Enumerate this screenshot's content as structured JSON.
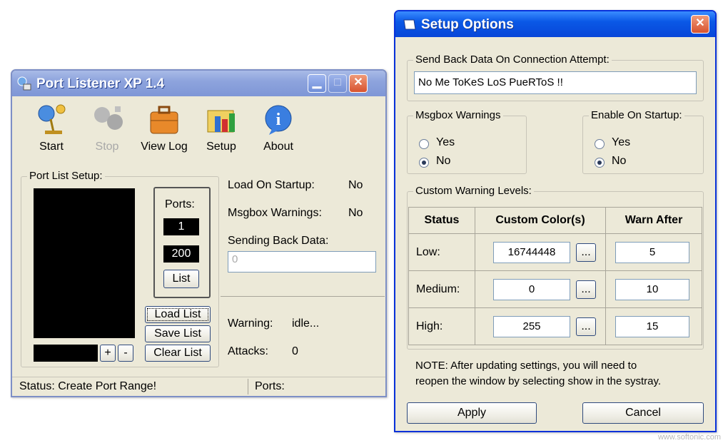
{
  "listener": {
    "title": "Port Listener XP 1.4",
    "toolbar": [
      {
        "label": "Start",
        "icon": "network-start-icon",
        "enabled": true
      },
      {
        "label": "Stop",
        "icon": "network-stop-icon",
        "enabled": false
      },
      {
        "label": "View Log",
        "icon": "briefcase-icon",
        "enabled": true
      },
      {
        "label": "Setup",
        "icon": "folder-setup-icon",
        "enabled": true
      },
      {
        "label": "About",
        "icon": "info-icon",
        "enabled": true
      }
    ],
    "port_list_setup": {
      "legend": "Port List Setup:",
      "ports_legend": "Ports:",
      "port_from": "1",
      "port_to": "200",
      "list_button": "List",
      "load_list": "Load List",
      "save_list": "Save List",
      "clear_list": "Clear List",
      "plus": "+",
      "minus": "-"
    },
    "info": {
      "load_on_startup_label": "Load On Startup:",
      "load_on_startup_value": "No",
      "msgbox_warnings_label": "Msgbox Warnings:",
      "msgbox_warnings_value": "No",
      "sending_back_label": "Sending Back Data:",
      "sending_back_value": "0",
      "warning_label": "Warning:",
      "warning_value": "idle...",
      "attacks_label": "Attacks:",
      "attacks_value": "0"
    },
    "status": {
      "left": "Status:  Create Port Range!",
      "right": "Ports:"
    }
  },
  "setup": {
    "title": "Setup Options",
    "send_back_legend": "Send Back Data On Connection Attempt:",
    "send_back_value": "No Me ToKeS LoS PueRToS !!",
    "msgbox_legend": "Msgbox Warnings",
    "startup_legend": "Enable On Startup:",
    "yes": "Yes",
    "no": "No",
    "levels_legend": "Custom Warning Levels:",
    "headers": {
      "status": "Status",
      "color": "Custom Color(s)",
      "warn": "Warn After"
    },
    "rows": [
      {
        "status": "Low:",
        "color": "16744448",
        "warn": "5"
      },
      {
        "status": "Medium:",
        "color": "0",
        "warn": "10"
      },
      {
        "status": "High:",
        "color": "255",
        "warn": "15"
      }
    ],
    "browse": "...",
    "note_line1": "NOTE:  After updating settings, you will need to",
    "note_line2": "reopen the window by selecting show in the systray.",
    "apply": "Apply",
    "cancel": "Cancel"
  },
  "watermark": "www.softonic.com",
  "colors": {
    "title_active": "#0a58e6",
    "title_inactive": "#8ea4dd",
    "face": "#ece9d8",
    "close": "#d8532f"
  }
}
